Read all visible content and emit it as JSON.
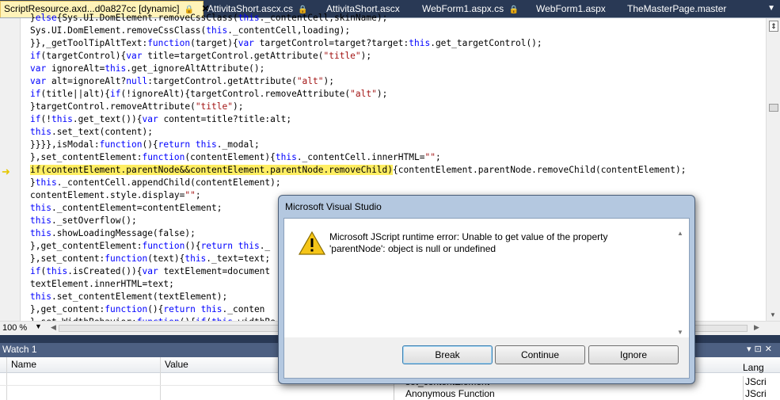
{
  "tabs": [
    {
      "label": "ScriptResource.axd...d0a827cc [dynamic]",
      "active": true,
      "locked": true,
      "closable": true
    },
    {
      "label": "AttivitaShort.ascx.cs",
      "locked": true
    },
    {
      "label": "AttivitaShort.ascx"
    },
    {
      "label": "WebForm1.aspx.cs",
      "locked": true
    },
    {
      "label": "WebForm1.aspx"
    },
    {
      "label": "TheMasterPage.master"
    }
  ],
  "code_lines": [
    "}else{Sys.UI.DomElement.removeCssClass(this._contentCell,skinName);",
    "Sys.UI.DomElement.removeCssClass(this._contentCell,loading);",
    "}},_getToolTipAltText:function(target){var targetControl=target?target:this.get_targetControl();",
    "if(targetControl){var title=targetControl.getAttribute(\"title\");",
    "var ignoreAlt=this.get_ignoreAltAttribute();",
    "var alt=ignoreAlt?null:targetControl.getAttribute(\"alt\");",
    "if(title||alt){if(!ignoreAlt){targetControl.removeAttribute(\"alt\");",
    "}targetControl.removeAttribute(\"title\");",
    "if(!this.get_text()){var content=title?title:alt;",
    "this.set_text(content);",
    "}}}},isModal:function(){return this._modal;",
    "},set_contentElement:function(contentElement){this._contentCell.innerHTML=\"\";",
    "if(contentElement.parentNode&&contentElement.parentNode.removeChild){contentElement.parentNode.removeChild(contentElement);",
    "}this._contentCell.appendChild(contentElement);",
    "contentElement.style.display=\"\";",
    "this._contentElement=contentElement;",
    "this._setOverflow();",
    "this.showLoadingMessage(false);",
    "},get_contentElement:function(){return this._",
    "},set_content:function(text){this._text=text;",
    "if(this.isCreated()){var textElement=document",
    "textElement.innerHTML=text;",
    "this.set_contentElement(textElement);",
    "},get_content:function(){return this._conten",
    "},set_WidthBehavior:function(){if(this.widthBe"
  ],
  "highlight": {
    "line_index": 12,
    "text": "if(contentElement.parentNode&&contentElement.parentNode.removeChild)"
  },
  "editor": {
    "zoom": "100 %"
  },
  "watch": {
    "title": "Watch 1",
    "columns": [
      "Name",
      "Value"
    ]
  },
  "callstack": {
    "language_header": "Lang",
    "rows": [
      {
        "name": "set_contentElement",
        "lang": "JScri",
        "current": true
      },
      {
        "name": "Anonymous Function",
        "lang": "JScri",
        "current": false
      }
    ]
  },
  "dialog": {
    "title": "Microsoft Visual Studio",
    "message": "Microsoft JScript runtime error: Unable to get value of the property 'parentNode': object is null or undefined",
    "buttons": [
      "Break",
      "Continue",
      "Ignore"
    ],
    "icon": "warning-icon"
  }
}
